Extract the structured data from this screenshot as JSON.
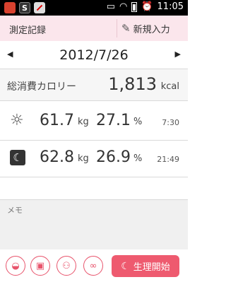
{
  "status_bar": {
    "time": "11:05",
    "left_icons": [
      "app-icon",
      "s-app-icon",
      "blocked-app-icon"
    ],
    "right_icons": [
      "voicemail-icon",
      "wifi-icon",
      "battery-icon",
      "alarm-icon"
    ]
  },
  "header": {
    "title": "測定記録",
    "new_entry_label": "新規入力",
    "background": "#fbe6ec"
  },
  "date_nav": {
    "date": "2012/7/26",
    "prev_symbol": "◀",
    "next_symbol": "▶"
  },
  "calories": {
    "label": "総消費カロリー",
    "value": "1,813",
    "unit": "kcal"
  },
  "measurements": [
    {
      "period_icon": "sun-icon",
      "weight": "61.7",
      "weight_unit": "kg",
      "body_fat": "27.1",
      "fat_unit": "%",
      "time": "7:30"
    },
    {
      "period_icon": "moon-icon",
      "weight": "62.8",
      "weight_unit": "kg",
      "body_fat": "26.9",
      "fat_unit": "%",
      "time": "21:49"
    }
  ],
  "memo": {
    "label": "メモ"
  },
  "toolbar": {
    "icons": [
      "food-icon",
      "bread-icon",
      "people-icon",
      "bandage-icon"
    ],
    "menstruation_start_label": "生理開始",
    "accent": "#ee5a6f"
  }
}
